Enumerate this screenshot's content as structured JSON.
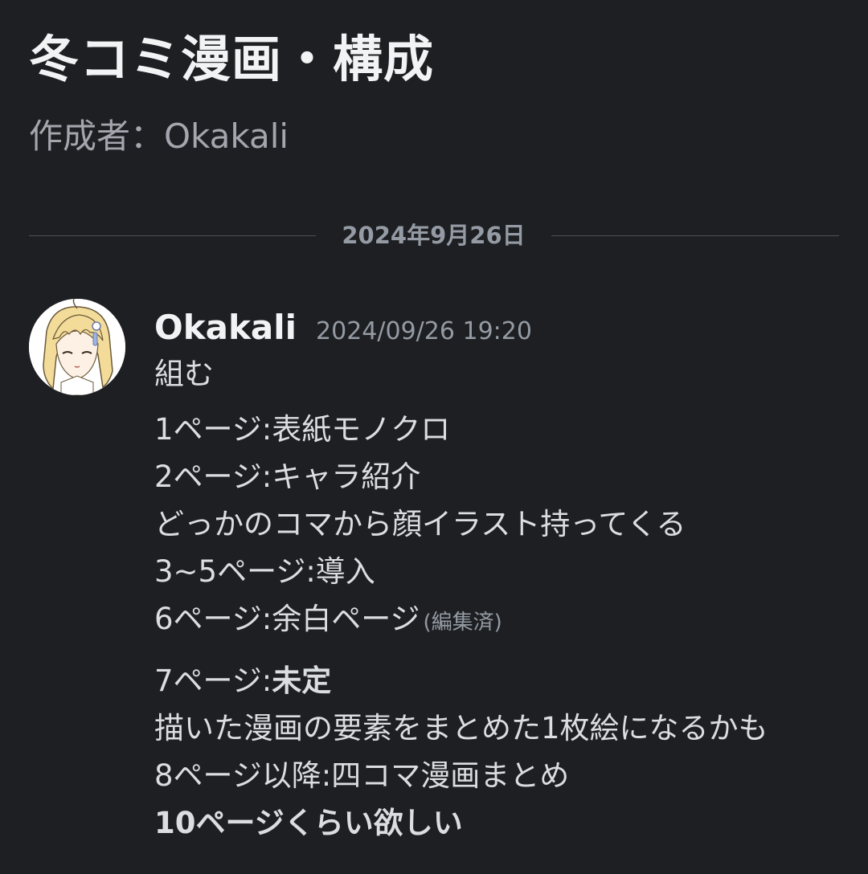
{
  "thread": {
    "title": "冬コミ漫画・構成",
    "author": "作成者：Okakali"
  },
  "divider": {
    "date": "2024年9月26日"
  },
  "message": {
    "username": "Okakali",
    "timestamp": "2024/09/26 19:20",
    "lines": {
      "l0": "組む",
      "l1": "1ページ:表紙モノクロ",
      "l2": "2ページ:キャラ紹介",
      "l3": "どっかのコマから顔イラスト持ってくる",
      "l4": "3~5ページ:導入",
      "l5": "6ページ:余白ページ",
      "l5_edited": "(編集済)",
      "l6_prefix": "7ページ:",
      "l6_bold": "未定",
      "l7": "描いた漫画の要素をまとめた1枚絵になるかも",
      "l8": "8ページ以降:四コマ漫画まとめ",
      "l9": "10ページくらい欲しい"
    }
  },
  "colors": {
    "background": "#1e1f22",
    "text": "#dbdee1",
    "muted": "#949ba4",
    "title": "#f2f3f5"
  }
}
